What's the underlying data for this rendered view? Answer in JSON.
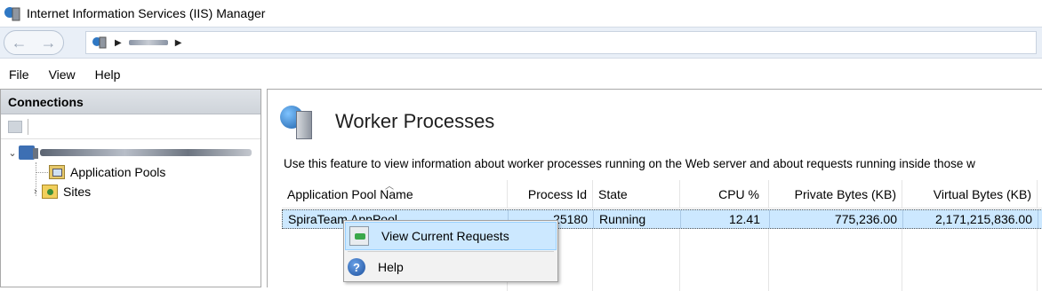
{
  "window": {
    "title": "Internet Information Services (IIS) Manager"
  },
  "menu": {
    "items": [
      "File",
      "View",
      "Help"
    ]
  },
  "connections": {
    "header": "Connections",
    "tree": {
      "app_pools": "Application Pools",
      "sites": "Sites"
    }
  },
  "feature": {
    "title": "Worker Processes",
    "description": "Use this feature to view information about worker processes running on the Web server and about requests running inside those w"
  },
  "grid": {
    "columns": [
      "Application Pool Name",
      "Process Id",
      "State",
      "CPU %",
      "Private Bytes (KB)",
      "Virtual Bytes (KB)"
    ],
    "rows": [
      [
        "SpiraTeam AppPool",
        "25180",
        "Running",
        "12.41",
        "775,236.00",
        "2,171,215,836.00"
      ]
    ]
  },
  "context_menu": {
    "items": [
      "View Current Requests",
      "Help"
    ]
  },
  "colors": {
    "selection": "#cce8ff",
    "accent": "#1c5fa8"
  },
  "icons": [
    "iis-icon",
    "back-icon",
    "forward-icon",
    "server-icon",
    "app-pools-icon",
    "sites-icon",
    "worker-processes-icon",
    "view-requests-icon",
    "help-icon"
  ]
}
